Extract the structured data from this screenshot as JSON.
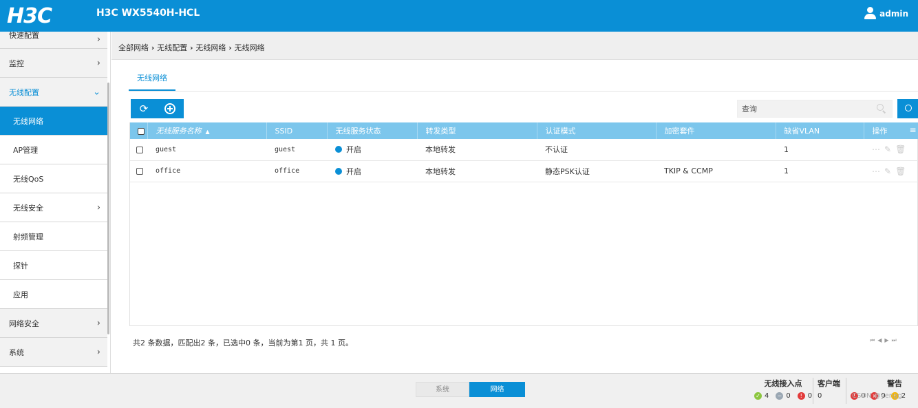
{
  "header": {
    "logo": "H3C",
    "device_title": "H3C WX5540H-HCL",
    "username": "admin"
  },
  "sidebar": {
    "items": [
      {
        "label": "快速配置"
      },
      {
        "label": "监控"
      },
      {
        "label": "无线配置"
      },
      {
        "label": "无线网络"
      },
      {
        "label": "AP管理"
      },
      {
        "label": "无线QoS"
      },
      {
        "label": "无线安全"
      },
      {
        "label": "射频管理"
      },
      {
        "label": "探针"
      },
      {
        "label": "应用"
      },
      {
        "label": "网络安全"
      },
      {
        "label": "系统"
      }
    ]
  },
  "breadcrumb": {
    "path": [
      "全部网络",
      "无线配置",
      "无线网络",
      "无线网络"
    ]
  },
  "tabs": [
    {
      "label": "无线网络"
    }
  ],
  "search": {
    "placeholder": "查询"
  },
  "table": {
    "columns": [
      "无线服务名称",
      "SSID",
      "无线服务状态",
      "转发类型",
      "认证模式",
      "加密套件",
      "缺省VLAN",
      "操作"
    ],
    "rows": [
      {
        "name": "guest",
        "ssid": "guest",
        "status": "开启",
        "forward": "本地转发",
        "auth": "不认证",
        "cipher": "",
        "vlan": "1"
      },
      {
        "name": "office",
        "ssid": "office",
        "status": "开启",
        "forward": "本地转发",
        "auth": "静态PSK认证",
        "cipher": "TKIP & CCMP",
        "vlan": "1"
      }
    ]
  },
  "summary": "共2 条数据，匹配出2 条，已选中0 条，当前为第1 页，共 1 页。",
  "footer": {
    "view_tabs": [
      "系统",
      "网络"
    ],
    "ap_title": "无线接入点",
    "ap_counts": [
      "4",
      "0",
      "0"
    ],
    "client_title": "客户端",
    "client_count": "0",
    "alarm_title": "警告",
    "alarm_counts": [
      "0",
      "0",
      "2"
    ],
    "watermark": "CSDN @yengg"
  },
  "colors": {
    "brand": "#0a8fd6",
    "table_header": "#7cc6ec"
  }
}
